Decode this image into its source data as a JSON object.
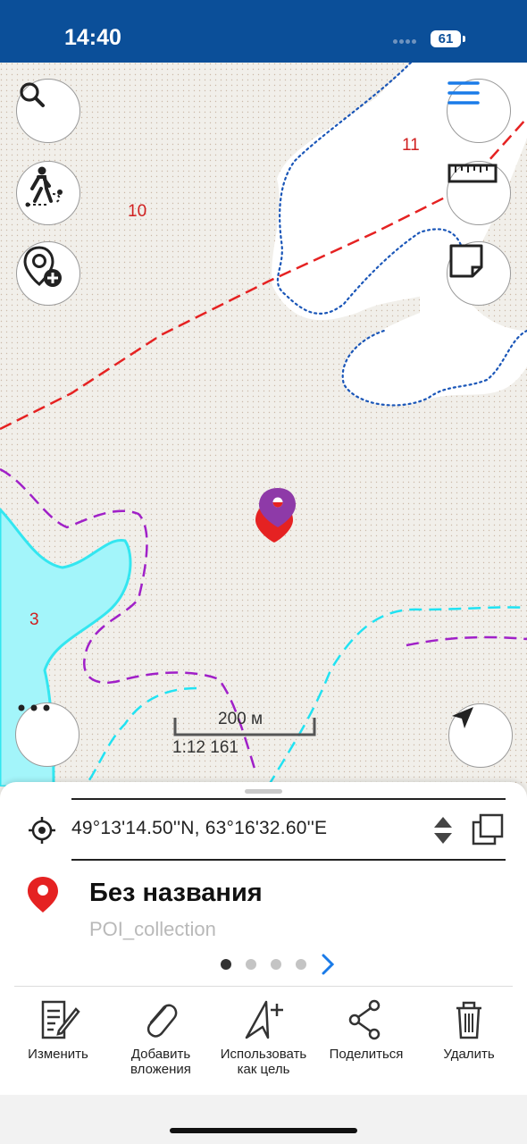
{
  "status_bar": {
    "time": "14:40",
    "battery": "61"
  },
  "map": {
    "labels": {
      "contour_10": "10",
      "contour_11": "11",
      "contour_3": "3"
    },
    "scale": {
      "distance": "200 м",
      "ratio": "1:12 161"
    },
    "colors": {
      "ground": "#f1efea",
      "water": "#a3f5fa",
      "red_line": "#e52222",
      "purple_line": "#a020c8",
      "blue_dotted": "#1a56b8",
      "cyan_dashed": "#20e2f2"
    }
  },
  "buttons": {
    "search": "search-icon",
    "track": "hiker-route-icon",
    "add_poi": "add-poi-icon",
    "menu": "hamburger-menu-icon",
    "ruler": "ruler-icon",
    "layers": "map-sheet-icon",
    "more": "more-dots-icon",
    "locate": "location-arrow-icon"
  },
  "poi_sheet": {
    "coordinates": "49°13'14.50''N, 63°16'32.60''E",
    "name": "Без названия",
    "collection": "POI_collection",
    "pages": 4,
    "active_page": 1,
    "actions": [
      {
        "id": "edit",
        "label": "Изменить",
        "icon": "edit-document-icon"
      },
      {
        "id": "attach",
        "label": "Добавить\nвложения",
        "icon": "paperclip-icon"
      },
      {
        "id": "target",
        "label": "Использовать\nкак цель",
        "icon": "navigate-plus-icon"
      },
      {
        "id": "share",
        "label": "Поделиться",
        "icon": "share-icon"
      },
      {
        "id": "delete",
        "label": "Удалить",
        "icon": "trash-icon"
      }
    ]
  }
}
